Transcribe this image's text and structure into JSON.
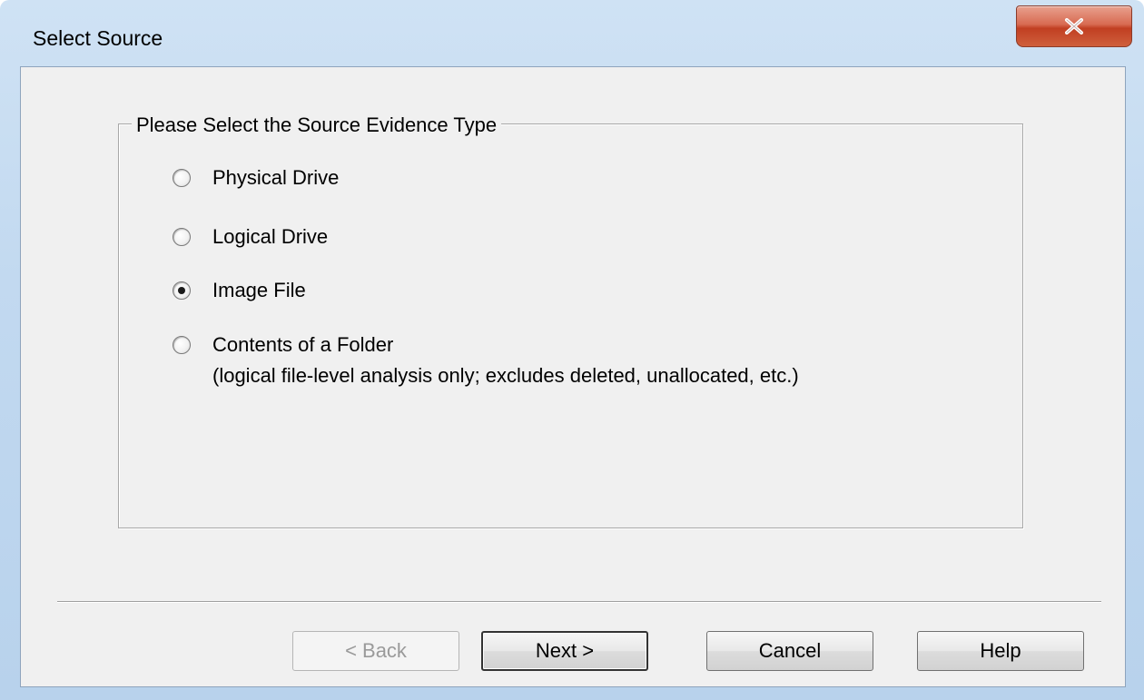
{
  "window": {
    "title": "Select Source",
    "close_icon": "close-x-icon"
  },
  "groupbox": {
    "label": "Please Select the Source Evidence Type"
  },
  "options": [
    {
      "label": "Physical Drive",
      "checked": false
    },
    {
      "label": "Logical Drive",
      "checked": false
    },
    {
      "label": "Image File",
      "checked": true
    },
    {
      "label": "Contents of a Folder",
      "sublabel": "(logical file-level analysis only; excludes deleted, unallocated, etc.)",
      "checked": false
    }
  ],
  "buttons": {
    "back": {
      "label": "< Back",
      "enabled": false
    },
    "next": {
      "label": "Next >",
      "enabled": true
    },
    "cancel": {
      "label": "Cancel",
      "enabled": true
    },
    "help": {
      "label": "Help",
      "enabled": true
    }
  }
}
